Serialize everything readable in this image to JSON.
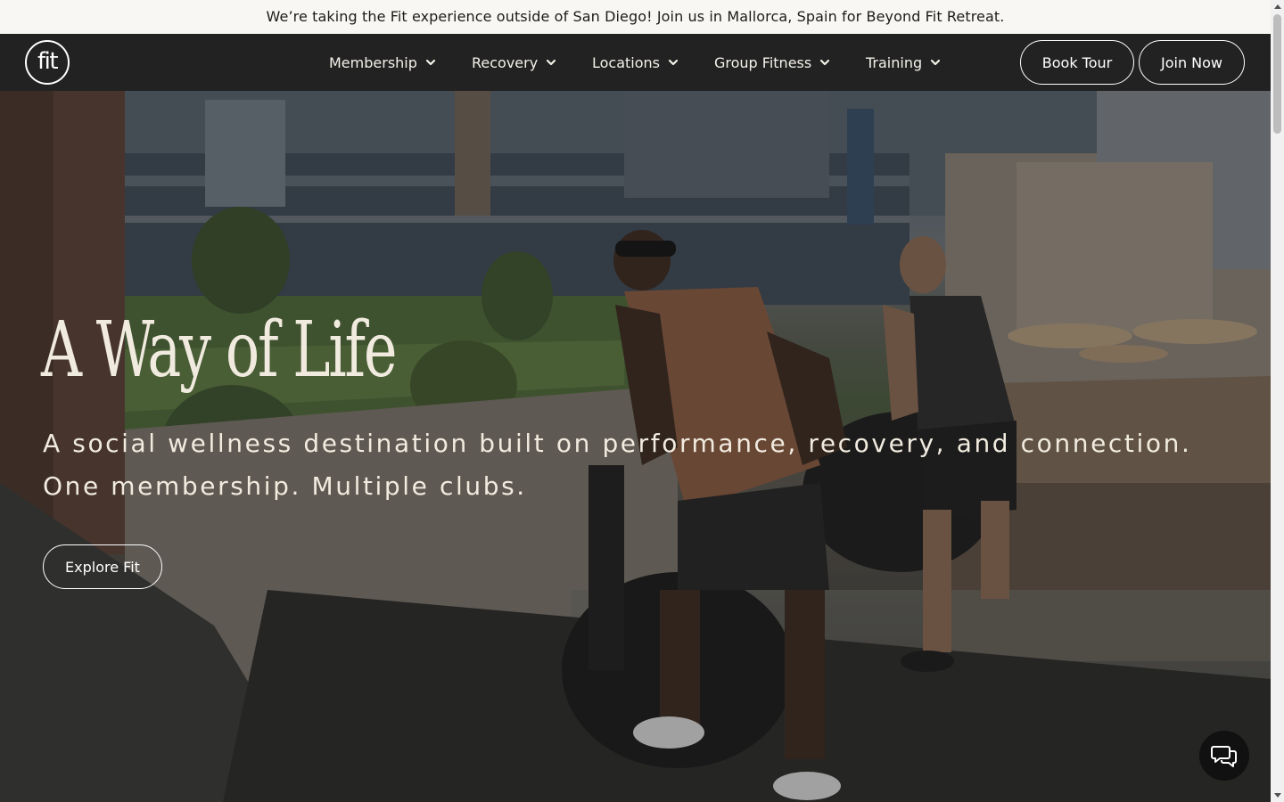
{
  "announcement": {
    "text": "We’re taking the Fit experience outside of San Diego! Join us in Mallorca, Spain for Beyond Fit Retreat."
  },
  "nav": {
    "logo_text": "fit",
    "menu": [
      {
        "label": "Membership",
        "icon": "chevron-down-icon"
      },
      {
        "label": "Recovery",
        "icon": "chevron-down-icon"
      },
      {
        "label": "Locations",
        "icon": "chevron-down-icon"
      },
      {
        "label": "Group Fitness",
        "icon": "chevron-down-icon"
      },
      {
        "label": "Training",
        "icon": "chevron-down-icon"
      }
    ],
    "book_tour_label": "Book Tour",
    "join_now_label": "Join Now"
  },
  "hero": {
    "title": "A Way of Life",
    "subtitle_line1": "A social wellness destination built on performance, recovery, and connection.",
    "subtitle_line2": "One membership. Multiple clubs.",
    "cta_label": "Explore Fit",
    "background_description_icon": "stadium-rooftop-photo"
  },
  "chat": {
    "icon": "chat-bubbles-icon"
  },
  "colors": {
    "announcement_bg": "#f8f7f3",
    "nav_bg": "#222222",
    "hero_text": "#f1ebdf",
    "chat_bg": "#111111"
  }
}
